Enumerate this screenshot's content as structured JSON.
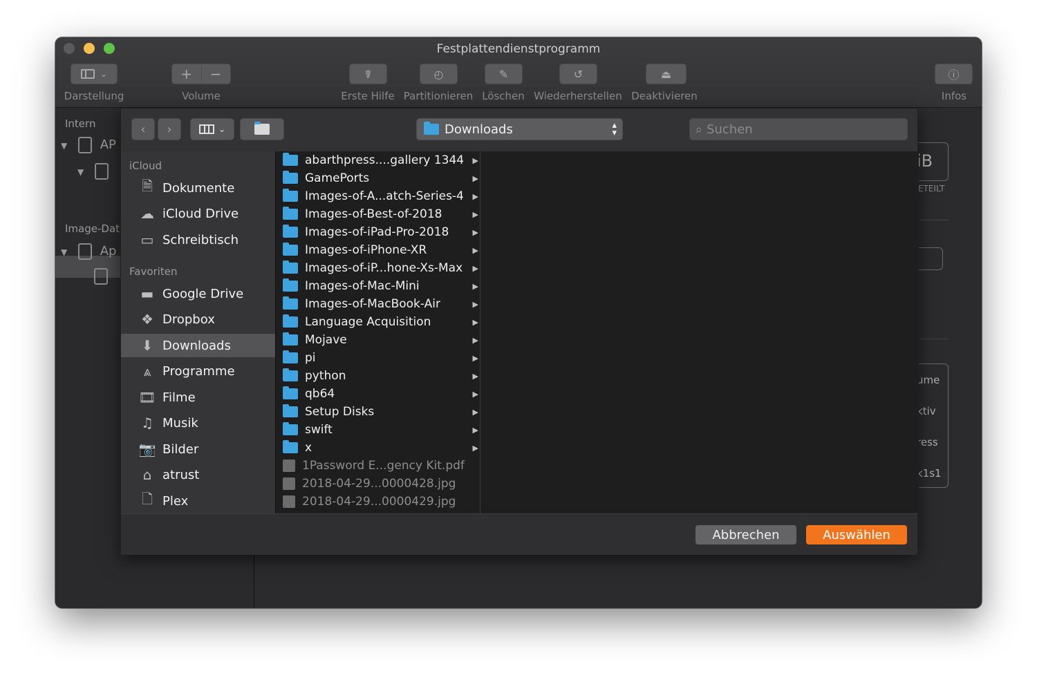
{
  "window": {
    "title": "Festplattendienstprogramm"
  },
  "toolbar": {
    "view_label": "Darstellung",
    "volume_label": "Volume",
    "firstaid_label": "Erste Hilfe",
    "partition_label": "Partitionieren",
    "erase_label": "Löschen",
    "restore_label": "Wiederherstellen",
    "unmount_label": "Deaktivieren",
    "info_label": "Infos",
    "volume_plus": "+",
    "volume_minus": "−"
  },
  "main_sidebar": {
    "intern_header": "Intern",
    "item_ap": "AP",
    "image_header": "Image-Dat",
    "item_ap2": "Ap"
  },
  "right_panel": {
    "size_frag": "iB",
    "shared_frag": "ETEILT",
    "r1": "ume",
    "r2": "ktiv",
    "r3": "ress",
    "r4": "k1s1"
  },
  "dialog": {
    "path": "Downloads",
    "search_placeholder": "Suchen",
    "sidebar": {
      "icloud_header": "iCloud",
      "icloud_items": [
        "Dokumente",
        "iCloud Drive",
        "Schreibtisch"
      ],
      "fav_header": "Favoriten",
      "fav_items": [
        "Google Drive",
        "Dropbox",
        "Downloads",
        "Programme",
        "Filme",
        "Musik",
        "Bilder",
        "atrust",
        "Plex"
      ]
    },
    "files": [
      "abarthpress....gallery 1344",
      "GamePorts",
      "Images-of-A...atch-Series-4",
      "Images-of-Best-of-2018",
      "Images-of-iPad-Pro-2018",
      "Images-of-iPhone-XR",
      "Images-of-iP...hone-Xs-Max",
      "Images-of-Mac-Mini",
      "Images-of-MacBook-Air",
      "Language Acquisition",
      "Mojave",
      "pi",
      "python",
      "qb64",
      "Setup Disks",
      "swift",
      "x",
      "1Password E...gency Kit.pdf",
      "2018-04-29...0000428.jpg",
      "2018-04-29...0000429.jpg"
    ],
    "cancel_label": "Abbrechen",
    "choose_label": "Auswählen"
  },
  "colors": {
    "accent": "#f2741d",
    "folder": "#3fa3e0"
  }
}
